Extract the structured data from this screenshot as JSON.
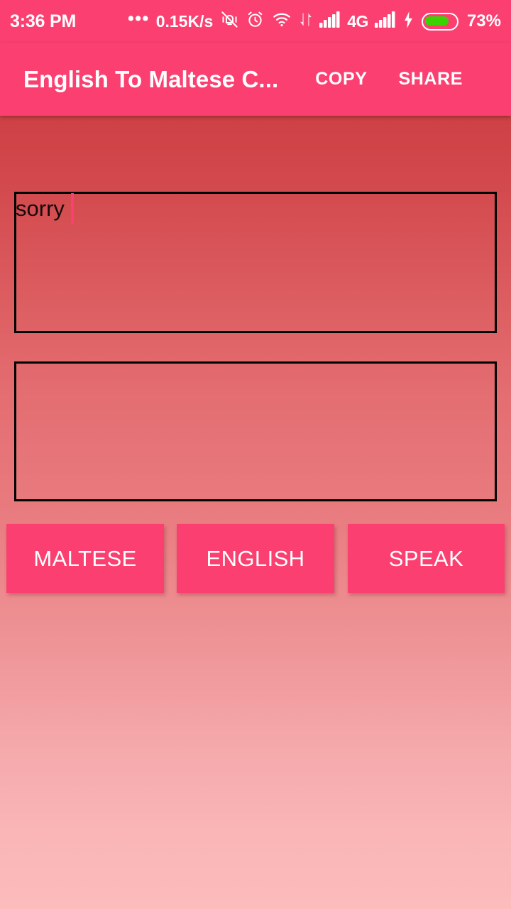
{
  "status_bar": {
    "time": "3:36 PM",
    "overflow_dots": "•••",
    "network_speed": "0.15K/s",
    "icons": [
      "vibrate-off-icon",
      "alarm-clock-icon",
      "wifi-icon",
      "data-transfer-icon",
      "signal-bars-icon",
      "signal-bars-2-icon",
      "charging-bolt-icon",
      "battery-icon"
    ],
    "network_type": "4G",
    "battery_percent": "73%",
    "battery_level": 73,
    "background_color": "#fb4071"
  },
  "app_bar": {
    "title": "English To Maltese C...",
    "copy_label": "COPY",
    "share_label": "SHARE",
    "background_color": "#fb4071"
  },
  "input_area": {
    "value": "sorry",
    "placeholder": "",
    "caret_color": "#fb4071",
    "border_color": "#000000"
  },
  "output_area": {
    "value": "",
    "placeholder": "",
    "border_color": "#000000"
  },
  "buttons": {
    "maltese_label": "MALTESE",
    "english_label": "ENGLISH",
    "speak_label": "SPEAK",
    "color": "#fb4071"
  },
  "theme": {
    "accent": "#fb4071",
    "background_top": "#c6333a",
    "background_bottom": "#fcbcbc",
    "battery_green": "#3ad200"
  }
}
